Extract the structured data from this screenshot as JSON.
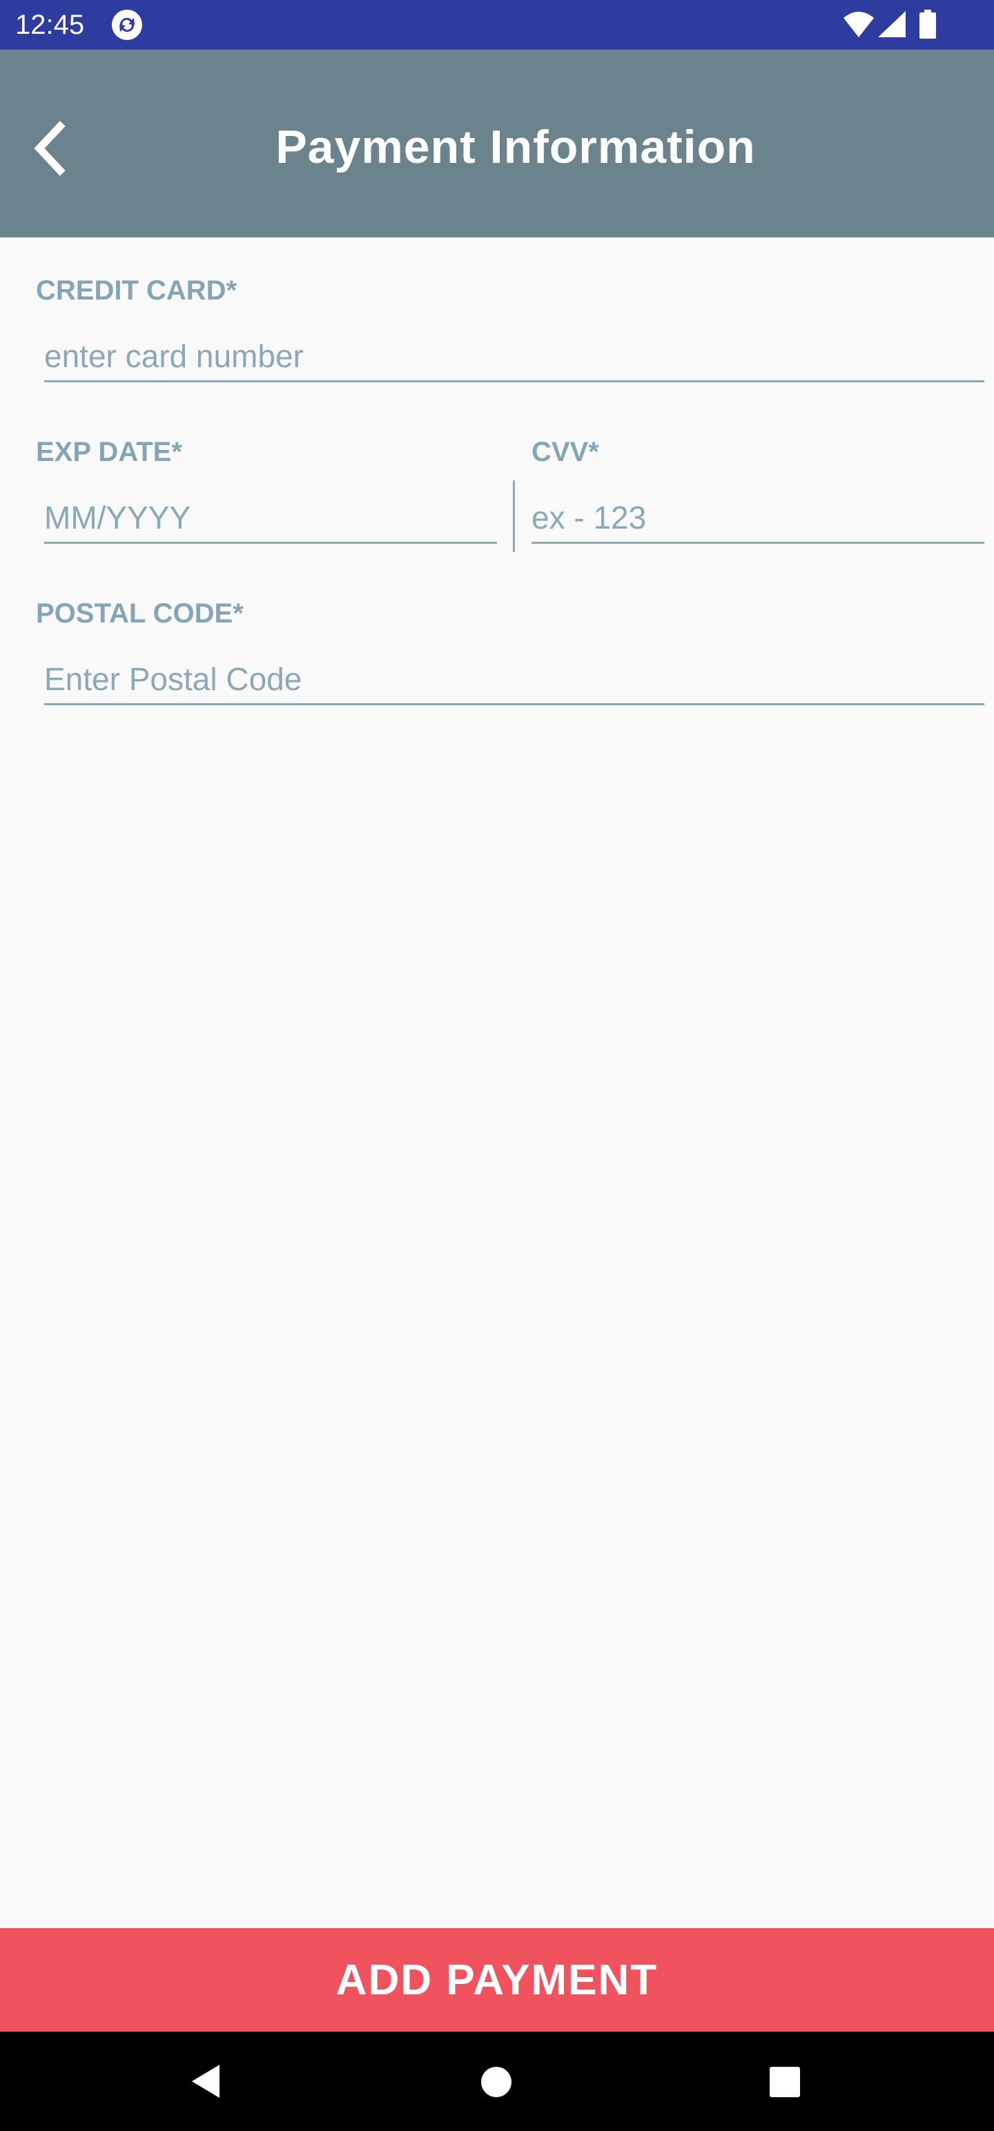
{
  "status_bar": {
    "time": "12:45",
    "icons": [
      "sync-app-icon",
      "wifi-icon",
      "cell-signal-icon",
      "battery-icon"
    ]
  },
  "header": {
    "title": "Payment Information",
    "back_icon": "chevron-left-icon"
  },
  "form": {
    "credit_card": {
      "label": "CREDIT CARD*",
      "placeholder": "enter card number",
      "value": ""
    },
    "exp_date": {
      "label": "EXP DATE*",
      "placeholder": "MM/YYYY",
      "value": ""
    },
    "cvv": {
      "label": "CVV*",
      "placeholder": "ex - 123",
      "value": ""
    },
    "postal_code": {
      "label": "POSTAL CODE*",
      "placeholder": "Enter Postal Code",
      "value": ""
    }
  },
  "actions": {
    "add_payment_label": "ADD PAYMENT"
  },
  "nav_bar": {
    "icons": [
      "nav-back-icon",
      "nav-home-icon",
      "nav-recents-icon"
    ]
  },
  "colors": {
    "status_bar": "#2f3c9f",
    "app_bar": "#6b838c",
    "label": "#85a5b6",
    "underline": "#8aa9b7",
    "button": "#f1535e",
    "background": "#f9f9f9"
  }
}
